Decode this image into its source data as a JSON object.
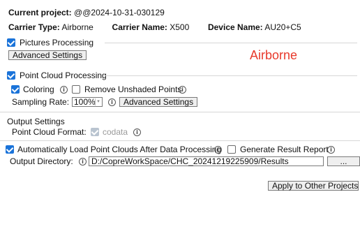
{
  "project": {
    "label": "Current project:",
    "name": "@@2024-10-31-030129"
  },
  "carrier": {
    "type_label": "Carrier Type:",
    "type_value": "Airborne",
    "name_label": "Carrier Name:",
    "name_value": "X500",
    "device_label": "Device Name:",
    "device_value": "AU20+C5"
  },
  "pictures": {
    "label": "Pictures Processing",
    "checked": true,
    "advanced_button": "Advanced Settings",
    "annotation": "Airborne",
    "annotation_color": "#e8392b"
  },
  "point_cloud": {
    "label": "Point Cloud Processing",
    "checked": true,
    "coloring_label": "Coloring",
    "coloring_checked": true,
    "remove_unshaded_label": "Remove Unshaded Points",
    "remove_unshaded_checked": false,
    "sampling_label": "Sampling Rate:",
    "sampling_value": "100%",
    "advanced_button": "Advanced Settings"
  },
  "output": {
    "section_title": "Output Settings",
    "format_label": "Point Cloud Format:",
    "format_value": "codata",
    "format_checked": true,
    "auto_load_label": "Automatically Load Point Clouds After Data Processing",
    "auto_load_checked": true,
    "report_label": "Generate Result Report",
    "report_checked": false,
    "directory_label": "Output Directory:",
    "directory_value": "D:/CopreWorkSpace/CHC_20241219225909/Results",
    "browse_button": "...",
    "apply_button": "Apply to Other Projects"
  },
  "icons": {
    "info": "info-icon",
    "check": "checkbox-checked-icon"
  },
  "colors": {
    "accent": "#1a73d9"
  }
}
